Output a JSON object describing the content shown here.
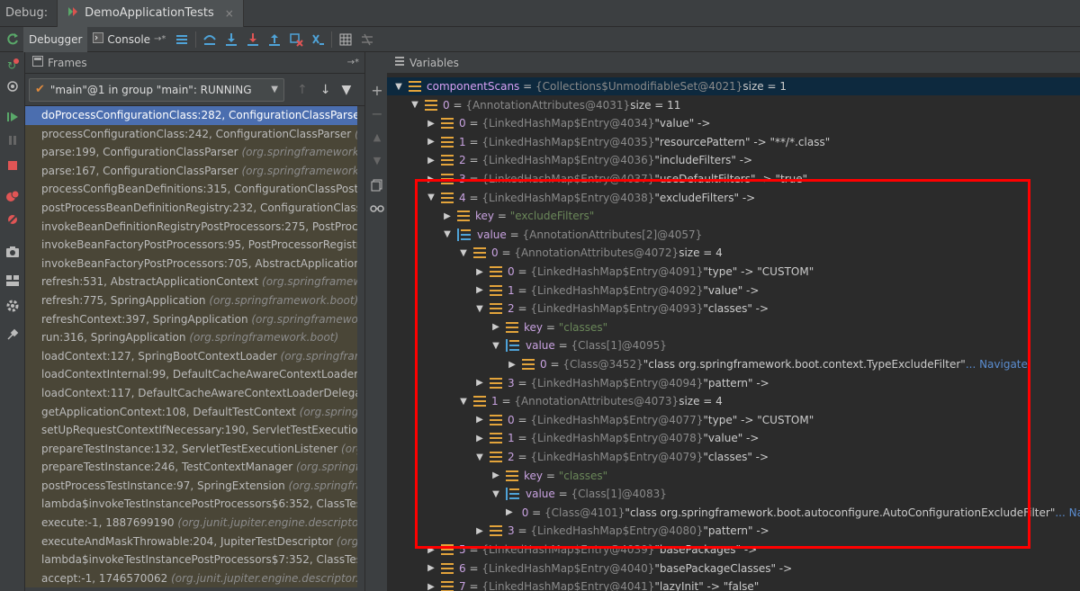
{
  "debug_bar": {
    "label": "Debug:",
    "tab_title": "DemoApplicationTests",
    "close_glyph": "×"
  },
  "toolbar": {
    "debugger_tab": "Debugger",
    "console_tab": "Console"
  },
  "frames": {
    "title": "Frames",
    "thread": "\"main\"@1 in group \"main\": RUNNING",
    "items": [
      {
        "m": "doProcessConfigurationClass:282, ConfigurationClassParser ",
        "c": "(org.spri"
      },
      {
        "m": "processConfigurationClass:242, ConfigurationClassParser ",
        "c": "(org.spri"
      },
      {
        "m": "parse:199, ConfigurationClassParser ",
        "c": "(org.springframework.context"
      },
      {
        "m": "parse:167, ConfigurationClassParser ",
        "c": "(org.springframework.context"
      },
      {
        "m": "processConfigBeanDefinitions:315, ConfigurationClassPostProcess",
        "c": ""
      },
      {
        "m": "postProcessBeanDefinitionRegistry:232, ConfigurationClassPostPr",
        "c": ""
      },
      {
        "m": "invokeBeanDefinitionRegistryPostProcessors:275, PostProcessorRe",
        "c": ""
      },
      {
        "m": "invokeBeanFactoryPostProcessors:95, PostProcessorRegistrationDe",
        "c": ""
      },
      {
        "m": "invokeBeanFactoryPostProcessors:705, AbstractApplicationContex",
        "c": ""
      },
      {
        "m": "refresh:531, AbstractApplicationContext ",
        "c": "(org.springframework.cor"
      },
      {
        "m": "refresh:775, SpringApplication ",
        "c": "(org.springframework.boot)"
      },
      {
        "m": "refreshContext:397, SpringApplication ",
        "c": "(org.springframework.boot"
      },
      {
        "m": "run:316, SpringApplication ",
        "c": "(org.springframework.boot)"
      },
      {
        "m": "loadContext:127, SpringBootContextLoader ",
        "c": "(org.springframework"
      },
      {
        "m": "loadContextInternal:99, DefaultCacheAwareContextLoaderDelega",
        "c": ""
      },
      {
        "m": "loadContext:117, DefaultCacheAwareContextLoaderDelegate ",
        "c": "(org"
      },
      {
        "m": "getApplicationContext:108, DefaultTestContext ",
        "c": "(org.springframew"
      },
      {
        "m": "setUpRequestContextIfNecessary:190, ServletTestExecutionListene",
        "c": ""
      },
      {
        "m": "prepareTestInstance:132, ServletTestExecutionListener ",
        "c": "(org.springf"
      },
      {
        "m": "prepareTestInstance:246, TestContextManager ",
        "c": "(org.springframew"
      },
      {
        "m": "postProcessTestInstance:97, SpringExtension ",
        "c": "(org.springframew"
      },
      {
        "m": "lambda$invokeTestInstancePostProcessors$6:352, ClassTestDescrip",
        "c": ""
      },
      {
        "m": "execute:-1, 1887699190 ",
        "c": "(org.junit.jupiter.engine.descriptor.ClassTe"
      },
      {
        "m": "executeAndMaskThrowable:204, JupiterTestDescriptor ",
        "c": "(org.junit.ju"
      },
      {
        "m": "lambda$invokeTestInstancePostProcessors$7:352, ClassTestDescrip",
        "c": ""
      },
      {
        "m": "accept:-1, 1746570062 ",
        "c": "(org.junit.jupiter.engine.descriptor.ClassTe"
      }
    ]
  },
  "variables": {
    "title": "Variables",
    "rows": [
      {
        "d": 0,
        "tw": "▼",
        "ic": "f",
        "n": "componentScans",
        "t": "{Collections$UnmodifiableSet@4021}",
        "v": " size = 1"
      },
      {
        "d": 1,
        "tw": "▼",
        "ic": "f",
        "n": "0",
        "t": "{AnnotationAttributes@4031}",
        "v": " size = 11"
      },
      {
        "d": 2,
        "tw": "▶",
        "ic": "f",
        "n": "0",
        "t": "{LinkedHashMap$Entry@4034}",
        "v": " \"value\" ->"
      },
      {
        "d": 2,
        "tw": "▶",
        "ic": "f",
        "n": "1",
        "t": "{LinkedHashMap$Entry@4035}",
        "v": " \"resourcePattern\" -> \"**/*.class\""
      },
      {
        "d": 2,
        "tw": "▶",
        "ic": "f",
        "n": "2",
        "t": "{LinkedHashMap$Entry@4036}",
        "v": " \"includeFilters\" ->"
      },
      {
        "d": 2,
        "tw": "▶",
        "ic": "f",
        "n": "3",
        "t": "{LinkedHashMap$Entry@4037}",
        "v": " \"useDefaultFilters\" -> \"true\""
      },
      {
        "d": 2,
        "tw": "▼",
        "ic": "f",
        "n": "4",
        "t": "{LinkedHashMap$Entry@4038}",
        "v": " \"excludeFilters\" ->"
      },
      {
        "d": 3,
        "tw": "▶",
        "ic": "f",
        "n": "key",
        "s": "\"excludeFilters\""
      },
      {
        "d": 3,
        "tw": "▼",
        "ic": "a",
        "n": "value",
        "t": "{AnnotationAttributes[2]@4057}"
      },
      {
        "d": 4,
        "tw": "▼",
        "ic": "f",
        "n": "0",
        "t": "{AnnotationAttributes@4072}",
        "v": " size = 4"
      },
      {
        "d": 5,
        "tw": "▶",
        "ic": "f",
        "n": "0",
        "t": "{LinkedHashMap$Entry@4091}",
        "v": " \"type\" -> \"CUSTOM\""
      },
      {
        "d": 5,
        "tw": "▶",
        "ic": "f",
        "n": "1",
        "t": "{LinkedHashMap$Entry@4092}",
        "v": " \"value\" ->"
      },
      {
        "d": 5,
        "tw": "▼",
        "ic": "f",
        "n": "2",
        "t": "{LinkedHashMap$Entry@4093}",
        "v": " \"classes\" ->"
      },
      {
        "d": 6,
        "tw": "▶",
        "ic": "f",
        "n": "key",
        "s": "\"classes\""
      },
      {
        "d": 6,
        "tw": "▼",
        "ic": "a",
        "n": "value",
        "t": "{Class[1]@4095}"
      },
      {
        "d": 7,
        "tw": "▶",
        "ic": "f",
        "n": "0",
        "t": "{Class@3452}",
        "v": " \"class org.springframework.boot.context.TypeExcludeFilter\"",
        "nav": "... Navigate"
      },
      {
        "d": 5,
        "tw": "▶",
        "ic": "f",
        "n": "3",
        "t": "{LinkedHashMap$Entry@4094}",
        "v": " \"pattern\" ->"
      },
      {
        "d": 4,
        "tw": "▼",
        "ic": "f",
        "n": "1",
        "t": "{AnnotationAttributes@4073}",
        "v": " size = 4"
      },
      {
        "d": 5,
        "tw": "▶",
        "ic": "f",
        "n": "0",
        "t": "{LinkedHashMap$Entry@4077}",
        "v": " \"type\" -> \"CUSTOM\""
      },
      {
        "d": 5,
        "tw": "▶",
        "ic": "f",
        "n": "1",
        "t": "{LinkedHashMap$Entry@4078}",
        "v": " \"value\" ->"
      },
      {
        "d": 5,
        "tw": "▼",
        "ic": "f",
        "n": "2",
        "t": "{LinkedHashMap$Entry@4079}",
        "v": " \"classes\" ->"
      },
      {
        "d": 6,
        "tw": "▶",
        "ic": "f",
        "n": "key",
        "s": "\"classes\""
      },
      {
        "d": 6,
        "tw": "▼",
        "ic": "a",
        "n": "value",
        "t": "{Class[1]@4083}"
      },
      {
        "d": 7,
        "tw": "▶",
        "ic": "f",
        "n": "0",
        "t": "{Class@4101}",
        "v": " \"class org.springframework.boot.autoconfigure.AutoConfigurationExcludeFilter\"",
        "nav": "... Navigate"
      },
      {
        "d": 5,
        "tw": "▶",
        "ic": "f",
        "n": "3",
        "t": "{LinkedHashMap$Entry@4080}",
        "v": " \"pattern\" ->"
      },
      {
        "d": 2,
        "tw": "▶",
        "ic": "f",
        "n": "5",
        "t": "{LinkedHashMap$Entry@4039}",
        "v": " \"basePackages\" ->"
      },
      {
        "d": 2,
        "tw": "▶",
        "ic": "f",
        "n": "6",
        "t": "{LinkedHashMap$Entry@4040}",
        "v": " \"basePackageClasses\" ->"
      },
      {
        "d": 2,
        "tw": "▶",
        "ic": "f",
        "n": "7",
        "t": "{LinkedHashMap$Entry@4041}",
        "v": " \"lazyInit\" -> \"false\""
      }
    ]
  },
  "colors": {
    "highlight_box": "#ff0000",
    "selected_frame": "#4b6eaf",
    "field_icon": "#e3a43b",
    "array_icon": "#4fa3d8"
  }
}
